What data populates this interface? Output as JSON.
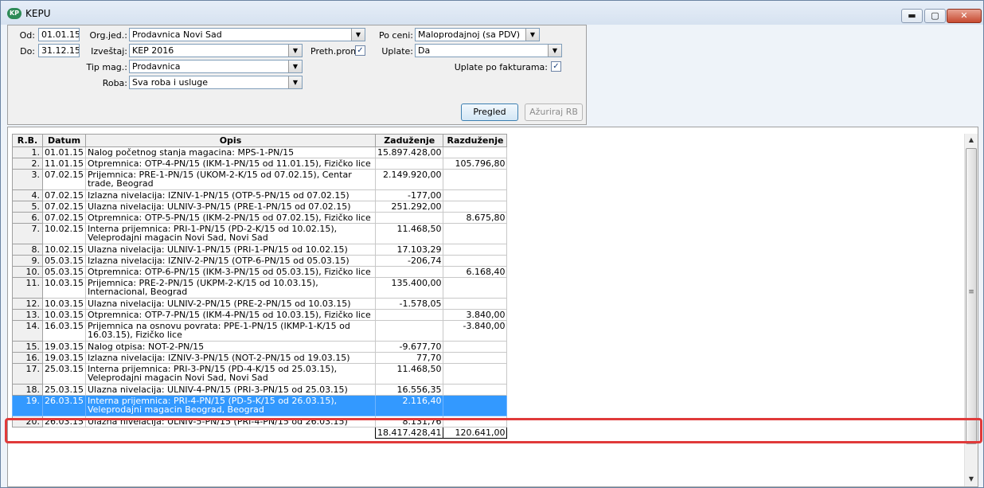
{
  "window": {
    "title": "KEPU",
    "icon_label": "KP",
    "controls": {
      "minimize": "▬",
      "maximize": "▢",
      "close": "✕"
    }
  },
  "filters": {
    "od_label": "Od:",
    "od_value": "01.01.15",
    "do_label": "Do:",
    "do_value": "31.12.15",
    "orgjed_label": "Org.jed.:",
    "orgjed_value": "Prodavnica Novi Sad",
    "izvestaj_label": "Izveštaj:",
    "izvestaj_value": "KEP 2016",
    "tipmag_label": "Tip mag.:",
    "tipmag_value": "Prodavnica",
    "roba_label": "Roba:",
    "roba_value": "Sva roba i usluge",
    "prethprom_label": "Preth.prom",
    "prethprom_checked": "✓",
    "poceni_label": "Po ceni:",
    "poceni_value": "Maloprodajnoj (sa PDV)",
    "uplate_label": "Uplate:",
    "uplate_value": "Da",
    "uplatefakt_label": "Uplate po fakturama:",
    "uplatefakt_checked": "✓",
    "pregled_label": "Pregled",
    "azuriraj_label": "Ažuriraj RB"
  },
  "table": {
    "headers": {
      "rb": "R.B.",
      "datum": "Datum",
      "opis": "Opis",
      "zaduzenje": "Zaduženje",
      "razduzenje": "Razduženje"
    },
    "rows": [
      {
        "rb": "1.",
        "datum": "01.01.15",
        "opis": "Nalog početnog stanja magacina: MPS-1-PN/15",
        "zad": "15.897.428,00",
        "raz": ""
      },
      {
        "rb": "2.",
        "datum": "11.01.15",
        "opis": "Otpremnica: OTP-4-PN/15 (IKM-1-PN/15 od 11.01.15), Fizičko lice",
        "zad": "",
        "raz": "105.796,80"
      },
      {
        "rb": "3.",
        "datum": "07.02.15",
        "opis": "Prijemnica: PRE-1-PN/15 (UKOM-2-K/15 od 07.02.15), Centar trade, Beograd",
        "zad": "2.149.920,00",
        "raz": ""
      },
      {
        "rb": "4.",
        "datum": "07.02.15",
        "opis": "Izlazna nivelacija: IZNIV-1-PN/15 (OTP-5-PN/15 od 07.02.15)",
        "zad": "-177,00",
        "raz": ""
      },
      {
        "rb": "5.",
        "datum": "07.02.15",
        "opis": "Ulazna nivelacija: ULNIV-3-PN/15 (PRE-1-PN/15 od 07.02.15)",
        "zad": "251.292,00",
        "raz": ""
      },
      {
        "rb": "6.",
        "datum": "07.02.15",
        "opis": "Otpremnica: OTP-5-PN/15 (IKM-2-PN/15 od 07.02.15), Fizičko lice",
        "zad": "",
        "raz": "8.675,80"
      },
      {
        "rb": "7.",
        "datum": "10.02.15",
        "opis": "Interna prijemnica: PRI-1-PN/15 (PD-2-K/15 od 10.02.15), Veleprodajni magacin Novi Sad, Novi Sad",
        "zad": "11.468,50",
        "raz": ""
      },
      {
        "rb": "8.",
        "datum": "10.02.15",
        "opis": "Ulazna nivelacija: ULNIV-1-PN/15 (PRI-1-PN/15 od 10.02.15)",
        "zad": "17.103,29",
        "raz": ""
      },
      {
        "rb": "9.",
        "datum": "05.03.15",
        "opis": "Izlazna nivelacija: IZNIV-2-PN/15 (OTP-6-PN/15 od 05.03.15)",
        "zad": "-206,74",
        "raz": ""
      },
      {
        "rb": "10.",
        "datum": "05.03.15",
        "opis": "Otpremnica: OTP-6-PN/15 (IKM-3-PN/15 od 05.03.15), Fizičko lice",
        "zad": "",
        "raz": "6.168,40"
      },
      {
        "rb": "11.",
        "datum": "10.03.15",
        "opis": "Prijemnica: PRE-2-PN/15 (UKPM-2-K/15 od 10.03.15), Internacional, Beograd",
        "zad": "135.400,00",
        "raz": ""
      },
      {
        "rb": "12.",
        "datum": "10.03.15",
        "opis": "Ulazna nivelacija: ULNIV-2-PN/15 (PRE-2-PN/15 od 10.03.15)",
        "zad": "-1.578,05",
        "raz": ""
      },
      {
        "rb": "13.",
        "datum": "10.03.15",
        "opis": "Otpremnica: OTP-7-PN/15 (IKM-4-PN/15 od 10.03.15), Fizičko lice",
        "zad": "",
        "raz": "3.840,00"
      },
      {
        "rb": "14.",
        "datum": "16.03.15",
        "opis": "Prijemnica na osnovu povrata: PPE-1-PN/15 (IKMP-1-K/15 od 16.03.15), Fizičko lice",
        "zad": "",
        "raz": "-3.840,00"
      },
      {
        "rb": "15.",
        "datum": "19.03.15",
        "opis": "Nalog otpisa: NOT-2-PN/15",
        "zad": "-9.677,70",
        "raz": ""
      },
      {
        "rb": "16.",
        "datum": "19.03.15",
        "opis": "Izlazna nivelacija: IZNIV-3-PN/15 (NOT-2-PN/15 od 19.03.15)",
        "zad": "77,70",
        "raz": ""
      },
      {
        "rb": "17.",
        "datum": "25.03.15",
        "opis": "Interna prijemnica: PRI-3-PN/15 (PD-4-K/15 od 25.03.15), Veleprodajni magacin Novi Sad, Novi Sad",
        "zad": "11.468,50",
        "raz": ""
      },
      {
        "rb": "18.",
        "datum": "25.03.15",
        "opis": "Ulazna nivelacija: ULNIV-4-PN/15 (PRI-3-PN/15 od 25.03.15)",
        "zad": "16.556,35",
        "raz": ""
      },
      {
        "rb": "19.",
        "datum": "26.03.15",
        "opis": "Interna prijemnica: PRI-4-PN/15 (PD-5-K/15 od 26.03.15), Veleprodajni magacin Beograd, Beograd",
        "zad": "2.116,40",
        "raz": ""
      },
      {
        "rb": "20.",
        "datum": "26.03.15",
        "opis": "Ulazna nivelacija: ULNIV-5-PN/15 (PRI-4-PN/15 od 26.03.15)",
        "zad": "8.131,76",
        "raz": ""
      }
    ],
    "selected_index": 18,
    "totals": {
      "zad": "18.417.428,41",
      "raz": "120.641,00"
    }
  },
  "scrollbar": {
    "up": "▲",
    "down": "▼",
    "grip": "≡"
  }
}
